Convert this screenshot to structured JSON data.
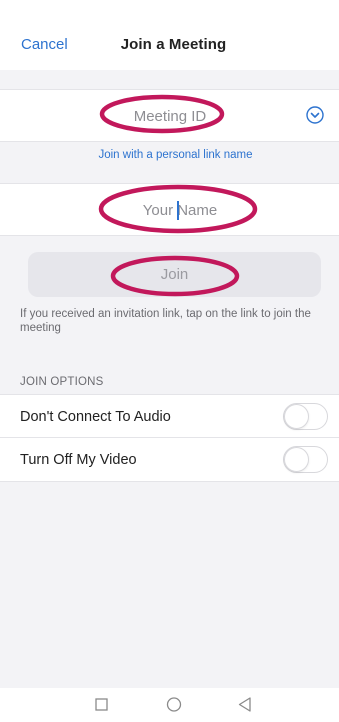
{
  "header": {
    "cancel_label": "Cancel",
    "title": "Join a Meeting"
  },
  "meeting_id": {
    "placeholder": "Meeting ID",
    "dropdown_icon": "chevron-down-circle-icon"
  },
  "personal_link_label": "Join with a personal link name",
  "name_field": {
    "placeholder": "Your Name"
  },
  "join_button_label": "Join",
  "invite_note": "If you received an invitation link, tap on the link to join the meeting",
  "join_options": {
    "header": "JOIN OPTIONS",
    "items": [
      {
        "label": "Don't Connect To Audio",
        "enabled": false
      },
      {
        "label": "Turn Off My Video",
        "enabled": false
      }
    ]
  },
  "nav_bar": {
    "icons": [
      "square-recents-icon",
      "circle-home-icon",
      "triangle-back-icon"
    ]
  },
  "colors": {
    "accent": "#2d73cf",
    "annotation": "#c2185b",
    "background": "#f3f3f6"
  }
}
